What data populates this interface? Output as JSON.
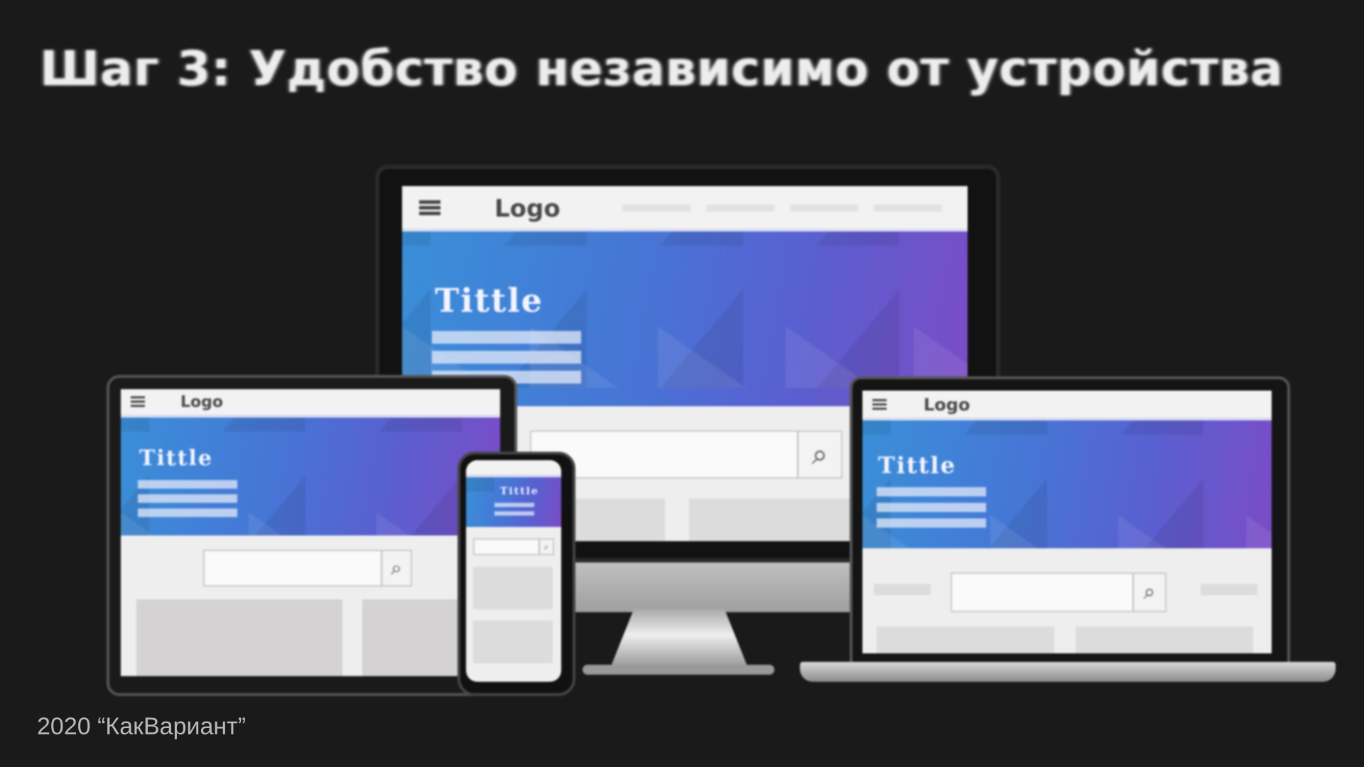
{
  "slide": {
    "title": "Шаг 3: Удобство независимо от устройства",
    "footer": "2020 “КакВариант”"
  },
  "mockup": {
    "logo_text": "Logo",
    "hero_title": "Tittle",
    "search_icon": "search-icon",
    "menu_icon": "hamburger-menu-icon"
  },
  "colors": {
    "background": "#1b1a1a",
    "hero_start": "#3a8fd8",
    "hero_end": "#7b4cc6"
  }
}
